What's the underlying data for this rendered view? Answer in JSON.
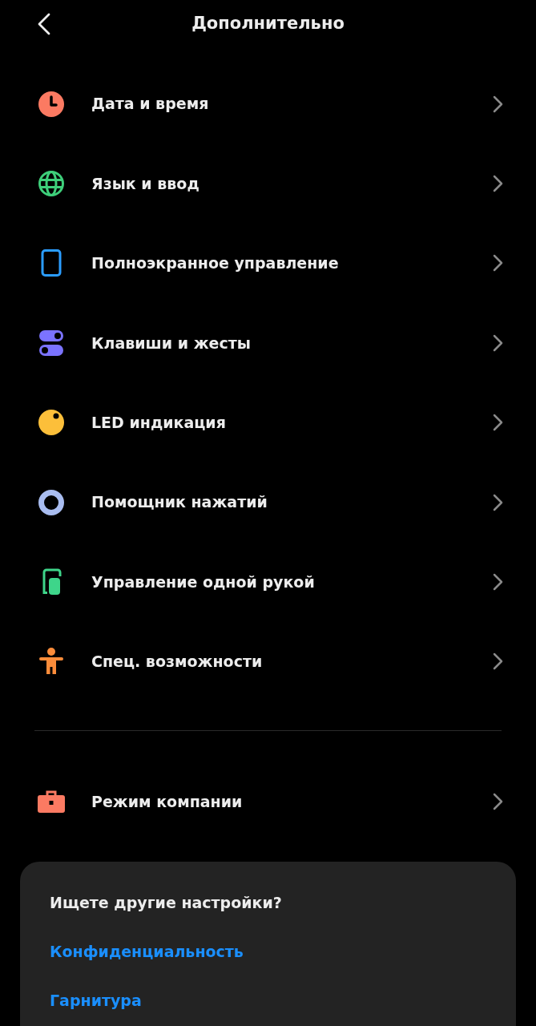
{
  "header": {
    "title": "Дополнительно"
  },
  "items": [
    {
      "kind": "clock",
      "label": "Дата и время"
    },
    {
      "kind": "globe",
      "label": "Язык и ввод"
    },
    {
      "kind": "phone",
      "label": "Полноэкранное управление"
    },
    {
      "kind": "toggles",
      "label": "Клавиши и жесты"
    },
    {
      "kind": "led",
      "label": "LED индикация"
    },
    {
      "kind": "ring",
      "label": "Помощник нажатий"
    },
    {
      "kind": "onehand",
      "label": "Управление одной рукой"
    },
    {
      "kind": "person",
      "label": "Спец. возможности"
    }
  ],
  "extra_items": [
    {
      "kind": "briefcase",
      "label": "Режим компании"
    }
  ],
  "suggestions": {
    "title": "Ищете другие настройки?",
    "links": [
      "Конфиденциальность",
      "Гарнитура"
    ]
  }
}
